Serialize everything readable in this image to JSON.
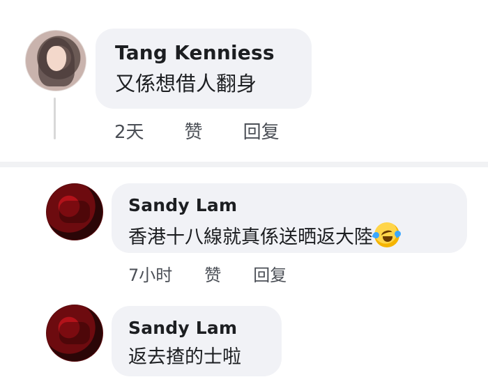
{
  "comments": [
    {
      "author": "Tang Kenniess",
      "text": "又係想借人翻身",
      "time": "2天",
      "like_label": "赞",
      "reply_label": "回复"
    },
    {
      "author": "Sandy Lam",
      "text": "香港十八線就真係送晒返大陸",
      "emoji": "laughing-crying-emoji",
      "time": "7小时",
      "like_label": "赞",
      "reply_label": "回复"
    },
    {
      "author": "Sandy Lam",
      "text": "返去揸的士啦"
    }
  ],
  "colors": {
    "bubble": "#f1f2f6",
    "text": "#1c1e21",
    "meta": "#4b4f56",
    "seam": "#f1f2f4"
  }
}
